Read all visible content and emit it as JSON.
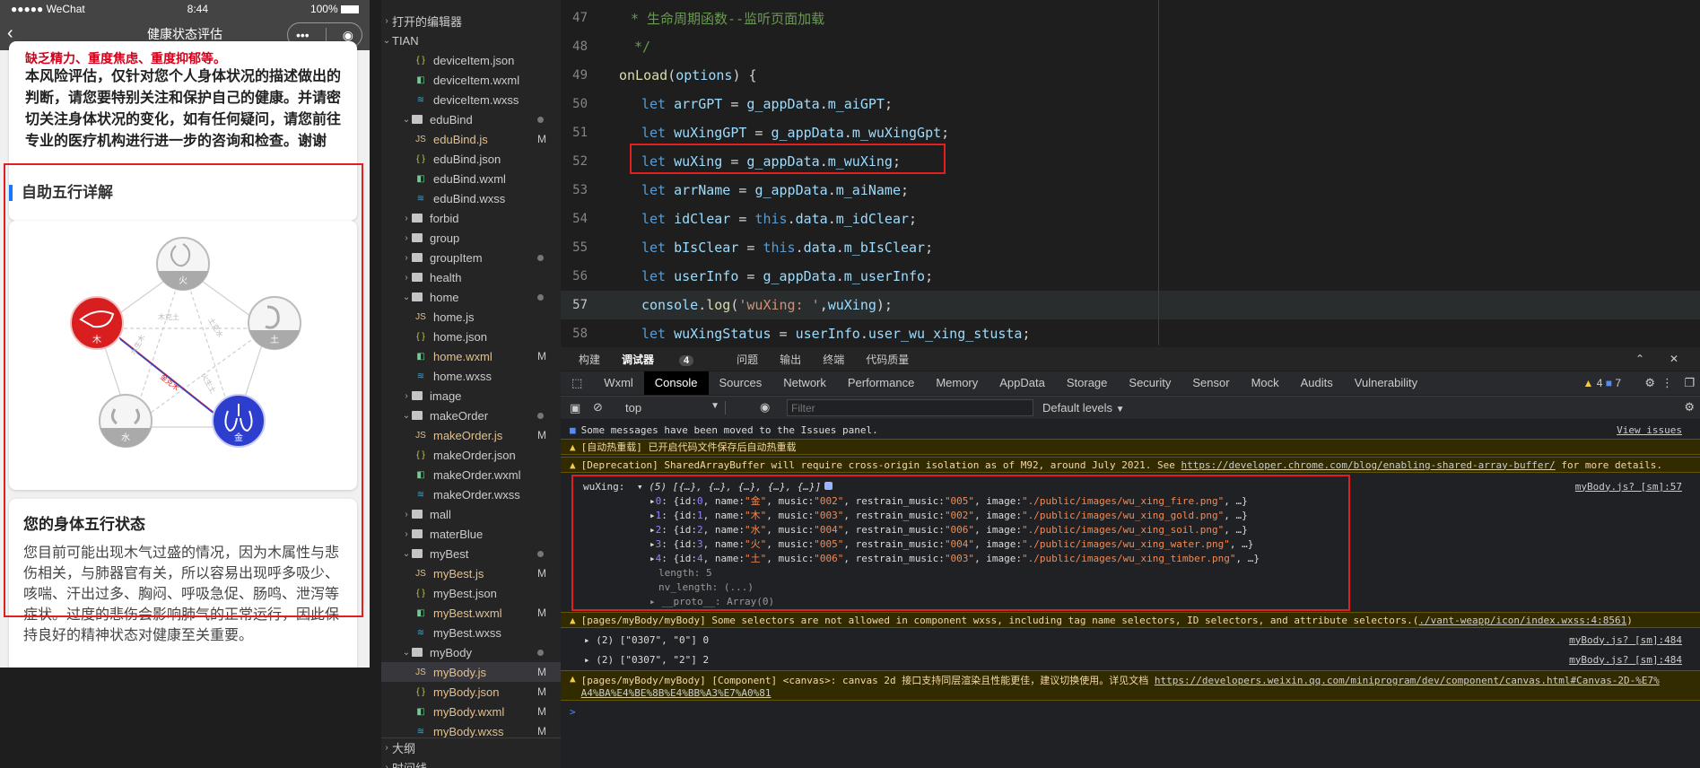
{
  "phone": {
    "status": {
      "carrier": "●●●●● WeChat",
      "time": "8:44",
      "battery": "100%"
    },
    "nav_title": "健康状态评估",
    "warn_text": "缺乏精力、重度焦虑、重度抑郁等。",
    "risk_text": "本风险评估，仅针对您个人身体状况的描述做出的判断，请您要特别关注和保护自己的健康。并请密切关注身体状况的变化，如有任何疑问，请您前往专业的医疗机构进行进一步的咨询和检查。谢谢",
    "section_title": "自助五行详解",
    "elements": [
      {
        "label": "火",
        "color": "#bbbbbb"
      },
      {
        "label": "土",
        "color": "#bbbbbb"
      },
      {
        "label": "金",
        "color": "#2d3ecf"
      },
      {
        "label": "水",
        "color": "#bbbbbb"
      },
      {
        "label": "木",
        "color": "#d81e1e"
      }
    ],
    "diagram_labels": [
      "木克土",
      "土克水",
      "金克木",
      "水生木",
      "火生土"
    ],
    "status_title": "您的身体五行状态",
    "status_text": "您目前可能出现木气过盛的情况，因为木属性与悲伤相关，与肺器官有关，所以容易出现呼多吸少、咳喘、汗出过多、胸闷、呼吸急促、肠鸣、泄泻等症状。过度的悲伤会影响肺气的正常运行，因此保持良好的精神状态对健康至关重要。"
  },
  "explorer": {
    "open_editors": "打开的编辑器",
    "root": "TIAN",
    "outline": "大纲",
    "timeline": "时间线",
    "rows": [
      {
        "name": "deviceItem.json",
        "type": "json",
        "indent": 2
      },
      {
        "name": "deviceItem.wxml",
        "type": "wxml",
        "indent": 2
      },
      {
        "name": "deviceItem.wxss",
        "type": "wxss",
        "indent": 2
      },
      {
        "name": "eduBind",
        "type": "folder-open",
        "indent": 1,
        "dot": true
      },
      {
        "name": "eduBind.js",
        "type": "js",
        "indent": 2,
        "mod": "M"
      },
      {
        "name": "eduBind.json",
        "type": "json",
        "indent": 2
      },
      {
        "name": "eduBind.wxml",
        "type": "wxml",
        "indent": 2
      },
      {
        "name": "eduBind.wxss",
        "type": "wxss",
        "indent": 2
      },
      {
        "name": "forbid",
        "type": "folder",
        "indent": 1
      },
      {
        "name": "group",
        "type": "folder",
        "indent": 1
      },
      {
        "name": "groupItem",
        "type": "folder",
        "indent": 1,
        "dot": true
      },
      {
        "name": "health",
        "type": "folder",
        "indent": 1
      },
      {
        "name": "home",
        "type": "folder-open",
        "indent": 1,
        "dot": true
      },
      {
        "name": "home.js",
        "type": "js",
        "indent": 2
      },
      {
        "name": "home.json",
        "type": "json",
        "indent": 2
      },
      {
        "name": "home.wxml",
        "type": "wxml",
        "indent": 2,
        "mod": "M"
      },
      {
        "name": "home.wxss",
        "type": "wxss",
        "indent": 2
      },
      {
        "name": "image",
        "type": "folder",
        "indent": 1
      },
      {
        "name": "makeOrder",
        "type": "folder-open",
        "indent": 1,
        "dot": true
      },
      {
        "name": "makeOrder.js",
        "type": "js",
        "indent": 2,
        "mod": "M"
      },
      {
        "name": "makeOrder.json",
        "type": "json",
        "indent": 2
      },
      {
        "name": "makeOrder.wxml",
        "type": "wxml",
        "indent": 2
      },
      {
        "name": "makeOrder.wxss",
        "type": "wxss",
        "indent": 2
      },
      {
        "name": "mall",
        "type": "folder",
        "indent": 1
      },
      {
        "name": "materBlue",
        "type": "folder",
        "indent": 1
      },
      {
        "name": "myBest",
        "type": "folder-open",
        "indent": 1,
        "dot": true
      },
      {
        "name": "myBest.js",
        "type": "js",
        "indent": 2,
        "mod": "M"
      },
      {
        "name": "myBest.json",
        "type": "json",
        "indent": 2
      },
      {
        "name": "myBest.wxml",
        "type": "wxml",
        "indent": 2,
        "mod": "M"
      },
      {
        "name": "myBest.wxss",
        "type": "wxss",
        "indent": 2
      },
      {
        "name": "myBody",
        "type": "folder-open",
        "indent": 1,
        "dot": true
      },
      {
        "name": "myBody.js",
        "type": "js",
        "indent": 2,
        "mod": "M",
        "selected": true
      },
      {
        "name": "myBody.json",
        "type": "json",
        "indent": 2,
        "mod": "M"
      },
      {
        "name": "myBody.wxml",
        "type": "wxml",
        "indent": 2,
        "mod": "M"
      },
      {
        "name": "myBody.wxss",
        "type": "wxss",
        "indent": 2,
        "mod": "M"
      }
    ]
  },
  "editor": {
    "lines": [
      {
        "n": "47",
        "text": "* 生命周期函数--监听页面加载"
      },
      {
        "n": "48",
        "text": "*/"
      },
      {
        "n": "49",
        "text": "onLoad(options) {"
      },
      {
        "n": "50",
        "text": "let arrGPT = g_appData.m_aiGPT;"
      },
      {
        "n": "51",
        "text": "let wuXingGPT = g_appData.m_wuXingGpt;"
      },
      {
        "n": "52",
        "text": "let wuXing = g_appData.m_wuXing;"
      },
      {
        "n": "53",
        "text": "let arrName = g_appData.m_aiName;"
      },
      {
        "n": "54",
        "text": "let idClear = this.data.m_idClear;"
      },
      {
        "n": "55",
        "text": "let bIsClear = this.data.m_bIsClear;"
      },
      {
        "n": "56",
        "text": "let userInfo = g_appData.m_userInfo;"
      },
      {
        "n": "57",
        "text": "console.log('wuXing: ',wuXing);"
      },
      {
        "n": "58",
        "text": "let wuXingStatus = userInfo.user_wu_xing_stusta;"
      }
    ]
  },
  "panel_tabs": [
    "构建",
    "调试器",
    "问题",
    "输出",
    "终端",
    "代码质量"
  ],
  "panel_badge": "4",
  "devtools": {
    "tabs": [
      "Wxml",
      "Console",
      "Sources",
      "Network",
      "Performance",
      "Memory",
      "AppData",
      "Storage",
      "Security",
      "Sensor",
      "Mock",
      "Audits",
      "Vulnerability"
    ],
    "warn_count": "4",
    "info_count": "7",
    "context": "top",
    "filter_placeholder": "Filter",
    "levels": "Default levels"
  },
  "console": {
    "issues_msg": "Some messages have been moved to the Issues panel.",
    "issues_link": "View issues",
    "hot_reload": "[自动热重载] 已开启代码文件保存后自动热重载",
    "deprecation": "[Deprecation] SharedArrayBuffer will require cross-origin isolation as of M92, around July 2021. See",
    "deprecation_link": "https://developer.chrome.com/blog/enabling-shared-array-buffer/",
    "deprecation_tail": "for more details.",
    "wuxing_label": "wuXing:",
    "wuxing_summary": "▾ (5) [{…}, {…}, {…}, {…}, {…}]",
    "wuxing_src": "myBody.js? [sm]:57",
    "items": [
      {
        "idx": "0",
        "id": "0",
        "name": "\"金\"",
        "music": "\"002\"",
        "restrain": "\"005\"",
        "image": "\"./public/images/wu_xing_fire.png\""
      },
      {
        "idx": "1",
        "id": "1",
        "name": "\"木\"",
        "music": "\"003\"",
        "restrain": "\"002\"",
        "image": "\"./public/images/wu_xing_gold.png\""
      },
      {
        "idx": "2",
        "id": "2",
        "name": "\"水\"",
        "music": "\"004\"",
        "restrain": "\"006\"",
        "image": "\"./public/images/wu_xing_soil.png\""
      },
      {
        "idx": "3",
        "id": "3",
        "name": "\"火\"",
        "music": "\"005\"",
        "restrain": "\"004\"",
        "image": "\"./public/images/wu_xing_water.png\""
      },
      {
        "idx": "4",
        "id": "4",
        "name": "\"土\"",
        "music": "\"006\"",
        "restrain": "\"003\"",
        "image": "\"./public/images/wu_xing_timber.png\""
      }
    ],
    "length_line": "length: 5",
    "nv_length_line": "nv_length: (...)",
    "proto_line": "▸ __proto__: Array(0)",
    "selector_warn": "[pages/myBody/myBody] Some selectors are not allowed in component wxss, including tag name selectors, ID selectors, and attribute selectors.(",
    "selector_link": "./vant-weapp/icon/index.wxss:4:8561",
    "selector_close": ")",
    "log1": "▸ (2) [\"0307\", \"0\"] 0",
    "log1_src": "myBody.js? [sm]:484",
    "log2": "▸ (2) [\"0307\", \"2\"] 2",
    "log2_src": "myBody.js? [sm]:484",
    "canvas_warn": "[pages/myBody/myBody] [Component] <canvas>: canvas 2d 接口支持同层渲染且性能更佳，建议切换使用。详见文档",
    "canvas_link1": "https://developers.weixin.qq.com/miniprogram/dev/component/canvas.html#Canvas-2D-%E7%",
    "canvas_link2": "A4%BA%E4%BE%8B%E4%BB%A3%E7%A0%81",
    "prompt": ">"
  }
}
